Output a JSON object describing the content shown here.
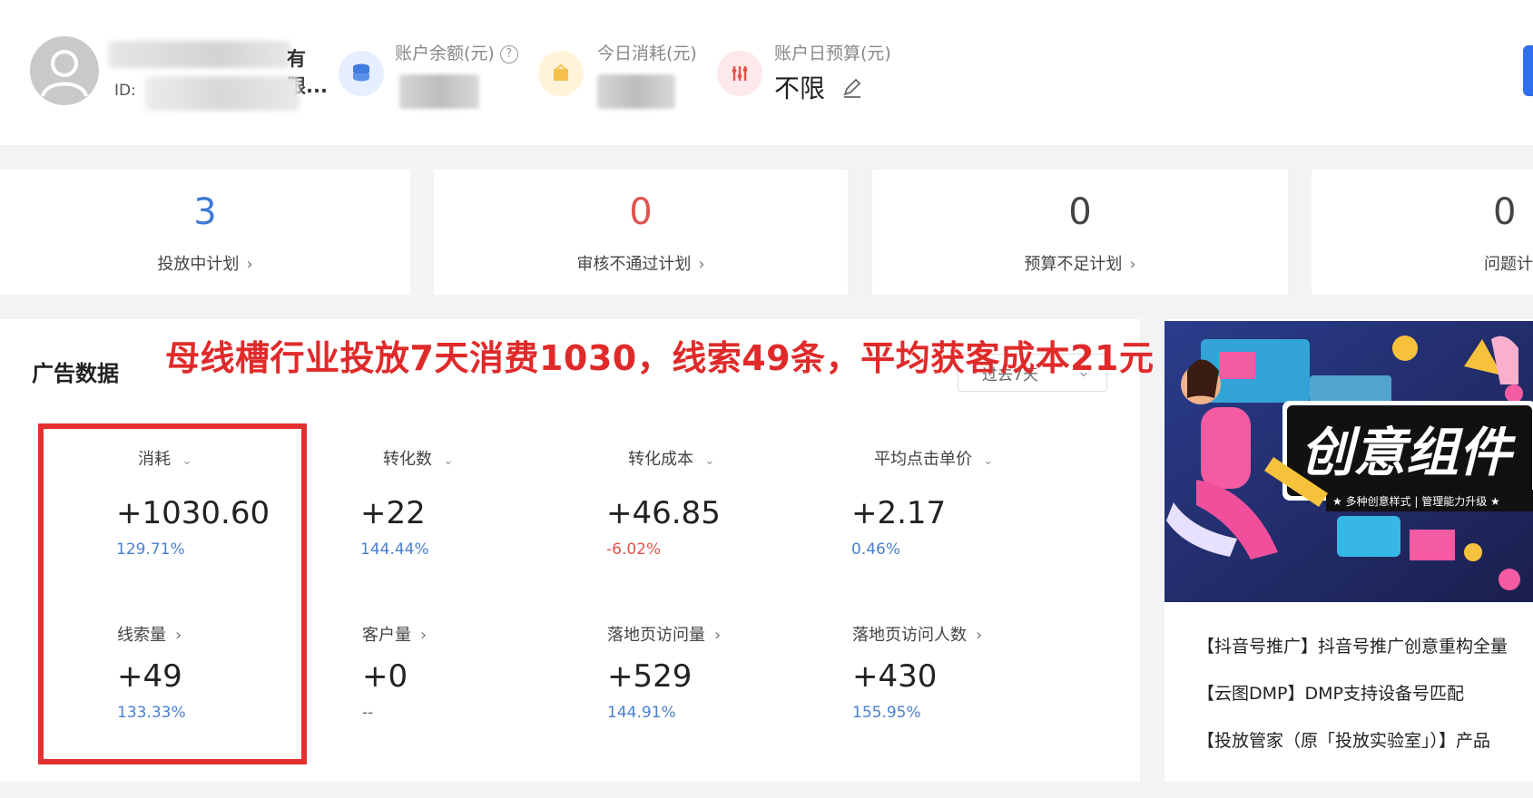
{
  "colors": {
    "accent_blue": "#2f6fed",
    "positive_pct": "#4a7fd1",
    "negative_pct": "#e2534d",
    "highlight_red": "#e53030",
    "overlay_red": "#e02a2a"
  },
  "header": {
    "account_name_suffix": "有限...",
    "id_label": "ID:",
    "balance": {
      "label": "账户余额(元)",
      "icon": "database-icon"
    },
    "today_spend": {
      "label": "今日消耗(元)",
      "icon": "wallet-icon"
    },
    "daily_budget": {
      "label": "账户日预算(元)",
      "value": "不限",
      "icon": "budget-icon"
    }
  },
  "summary_cards": [
    {
      "value": "3",
      "label": "投放中计划",
      "color": "#3d79d6"
    },
    {
      "value": "0",
      "label": "审核不通过计划",
      "color": "#e2534d"
    },
    {
      "value": "0",
      "label": "预算不足计划",
      "color": "#444444"
    },
    {
      "value": "0",
      "label": "问题计",
      "color": "#444444"
    }
  ],
  "ad_data": {
    "title": "广告数据",
    "annotation": "母线槽行业投放7天消费1030，线索49条，平均获客成本21元",
    "range": "过去7天",
    "metrics": [
      {
        "label": "消耗",
        "value": "+1030.60",
        "pct": "129.71%",
        "trend": "up"
      },
      {
        "label": "转化数",
        "value": "+22",
        "pct": "144.44%",
        "trend": "up"
      },
      {
        "label": "转化成本",
        "value": "+46.85",
        "pct": "-6.02%",
        "trend": "down"
      },
      {
        "label": "平均点击单价",
        "value": "+2.17",
        "pct": "0.46%",
        "trend": "up"
      },
      {
        "label": "线索量",
        "value": "+49",
        "pct": "133.33%",
        "trend": "up"
      },
      {
        "label": "客户量",
        "value": "+0",
        "pct": "--",
        "trend": "none"
      },
      {
        "label": "落地页访问量",
        "value": "+529",
        "pct": "144.91%",
        "trend": "up"
      },
      {
        "label": "落地页访问人数",
        "value": "+430",
        "pct": "155.95%",
        "trend": "up"
      }
    ]
  },
  "side": {
    "banner_title": "创意组件",
    "banner_subtitle": "★ 多种创意样式 | 管理能力升级 ★",
    "news": [
      "【抖音号推广】抖音号推广创意重构全量",
      "【云图DMP】DMP支持设备号匹配",
      "【投放管家（原「投放实验室」）】产品"
    ]
  }
}
